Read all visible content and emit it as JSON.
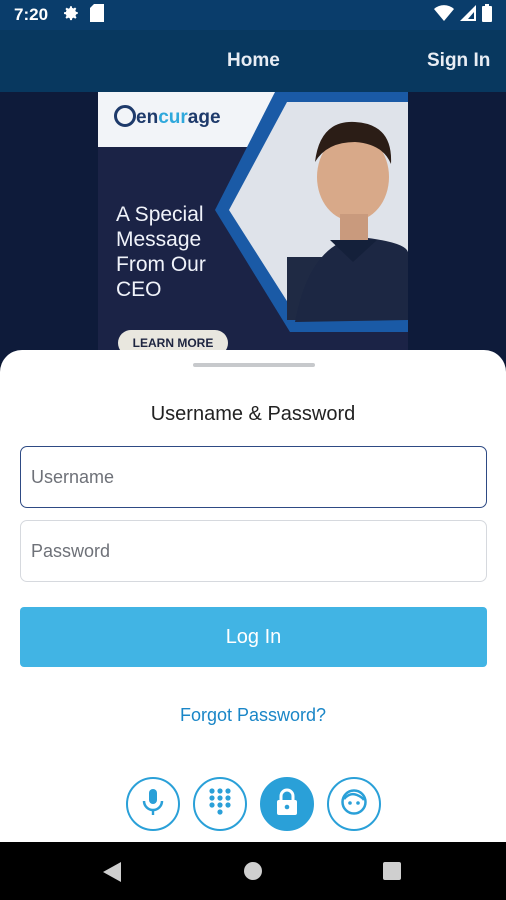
{
  "status_bar": {
    "time": "7:20",
    "icons_left": [
      "gear-icon",
      "sd-card-icon"
    ],
    "icons_right": [
      "wifi-icon",
      "signal-icon",
      "battery-icon"
    ]
  },
  "nav": {
    "home_label": "Home",
    "signin_label": "Sign In"
  },
  "banner": {
    "logo_text_1": "en",
    "logo_text_2": "cur",
    "logo_text_3": "age",
    "logo_subtext": "",
    "headline": "A Special Message From Our CEO",
    "button_label": "LEARN MORE"
  },
  "login": {
    "title": "Username & Password",
    "username_placeholder": "Username",
    "password_placeholder": "Password",
    "login_label": "Log In",
    "forgot_label": "Forgot Password?"
  },
  "auth_methods": [
    "microphone-icon",
    "keypad-icon",
    "lock-icon",
    "face-icon"
  ],
  "colors": {
    "status_bar": "#0a3d6b",
    "nav_bar": "#08385f",
    "accent": "#41b4e4",
    "link": "#1a86c7",
    "field_focus": "#2e4a84"
  }
}
